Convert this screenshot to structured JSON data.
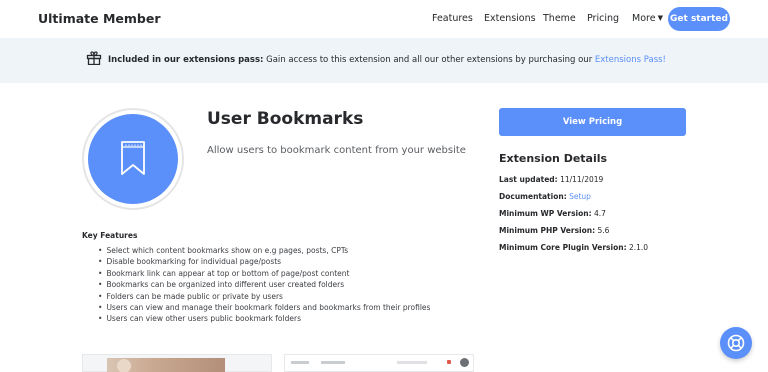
{
  "header": {
    "brand": "Ultimate Member",
    "nav": {
      "features": "Features",
      "extensions": "Extensions",
      "theme": "Theme",
      "pricing": "Pricing",
      "more": "More"
    },
    "cta": "Get started"
  },
  "notice": {
    "icon": "gift-icon",
    "bold": "Included in our extensions pass:",
    "text": " Gain access to this extension and all our other extensions by purchasing our ",
    "link": "Extensions Pass!"
  },
  "product": {
    "icon": "bookmark-icon",
    "title": "User Bookmarks",
    "subtitle": "Allow users to bookmark content from your website"
  },
  "sidebar": {
    "pricing_button": "View Pricing",
    "details_title": "Extension Details",
    "last_updated_label": "Last updated:",
    "last_updated_value": " 11/11/2019",
    "documentation_label": "Documentation:",
    "documentation_link": "Setup",
    "wp_label": "Minimum WP Version:",
    "wp_value": " 4.7",
    "php_label": "Minimum PHP Version:",
    "php_value": " 5.6",
    "core_label": "Minimum Core Plugin Version:",
    "core_value": " 2.1.0"
  },
  "features": {
    "title": "Key Features",
    "items": [
      "Select which content bookmarks show on e.g pages, posts, CPTs",
      "Disable bookmarking for individual page/posts",
      "Bookmark link can appear at top or bottom of page/post content",
      "Bookmarks can be organized into different user created folders",
      "Folders can be made public or private by users",
      "Users can view and manage their bookmark folders and bookmarks from their profiles",
      "Users can view other users public bookmark folders"
    ]
  },
  "help": {
    "icon": "lifebuoy-icon"
  },
  "colors": {
    "accent": "#5b8ff9",
    "notice_bg": "#eef4f8",
    "text": "#27292c"
  }
}
